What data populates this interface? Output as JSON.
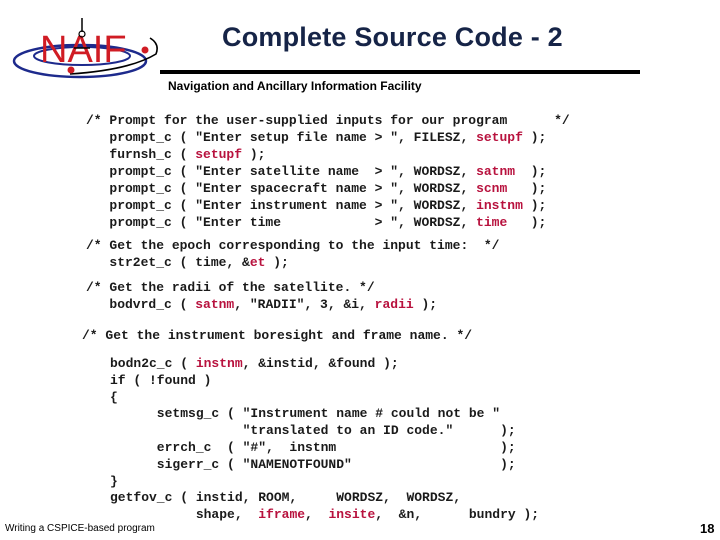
{
  "header": {
    "logo_text": "NAIF",
    "title": "Complete Source Code - 2",
    "subtitle": "Navigation and Ancillary Information Facility"
  },
  "colors": {
    "title": "#162447",
    "code_text": "#1a1a1a",
    "variable_highlight": "#b8123e",
    "logo_red": "#d01c24",
    "logo_orbit": "#1d2a8c"
  },
  "code_blocks": [
    {
      "name": "prompt-block",
      "lines": [
        [
          {
            "t": "/* Prompt for the user-supplied inputs for our program      */"
          }
        ],
        [
          {
            "t": "   prompt_c ( \"Enter setup file name > \", FILESZ, "
          },
          {
            "t": "setupf",
            "hl": true
          },
          {
            "t": " );"
          }
        ],
        [
          {
            "t": "   furnsh_c ( "
          },
          {
            "t": "setupf",
            "hl": true
          },
          {
            "t": " );"
          }
        ],
        [
          {
            "t": "   prompt_c ( \"Enter satellite name  > \", WORDSZ, "
          },
          {
            "t": "satnm",
            "hl": true
          },
          {
            "t": "  );"
          }
        ],
        [
          {
            "t": "   prompt_c ( \"Enter spacecraft name > \", WORDSZ, "
          },
          {
            "t": "scnm",
            "hl": true
          },
          {
            "t": "   );"
          }
        ],
        [
          {
            "t": "   prompt_c ( \"Enter instrument name > \", WORDSZ, "
          },
          {
            "t": "instnm",
            "hl": true
          },
          {
            "t": " );"
          }
        ],
        [
          {
            "t": "   prompt_c ( \"Enter time            > \", WORDSZ, "
          },
          {
            "t": "time",
            "hl": true
          },
          {
            "t": "   );"
          }
        ]
      ]
    },
    {
      "name": "epoch-block",
      "lines": [
        [
          {
            "t": "/* Get the epoch corresponding to the input time:  */"
          }
        ],
        [
          {
            "t": "   str2et_c ( time, &"
          },
          {
            "t": "et",
            "hl": true
          },
          {
            "t": " );"
          }
        ]
      ]
    },
    {
      "name": "radii-block",
      "lines": [
        [
          {
            "t": "/* Get the radii of the satellite. */"
          }
        ],
        [
          {
            "t": "   bodvrd_c ( "
          },
          {
            "t": "satnm",
            "hl": true
          },
          {
            "t": ", \"RADII\", 3, &i, "
          },
          {
            "t": "radii",
            "hl": true
          },
          {
            "t": " );"
          }
        ]
      ]
    },
    {
      "name": "boresight-comment",
      "lines": [
        [
          {
            "t": "/* Get the instrument boresight and frame name. */"
          }
        ]
      ]
    },
    {
      "name": "fov-block",
      "lines": [
        [
          {
            "t": "bodn2c_c ( "
          },
          {
            "t": "instnm",
            "hl": true
          },
          {
            "t": ", &instid, &found );"
          }
        ],
        [
          {
            "t": "if ( !found )"
          }
        ],
        [
          {
            "t": "{"
          }
        ],
        [
          {
            "t": "      setmsg_c ( \"Instrument name # could not be \""
          }
        ],
        [
          {
            "t": "                 \"translated to an ID code.\"      );"
          }
        ],
        [
          {
            "t": "      errch_c  ( \"#\",  instnm                     );"
          }
        ],
        [
          {
            "t": "      sigerr_c ( \"NAMENOTFOUND\"                   );"
          }
        ],
        [
          {
            "t": "}"
          }
        ],
        [
          {
            "t": "getfov_c ( instid, ROOM,     WORDSZ,  WORDSZ,"
          }
        ],
        [
          {
            "t": "           shape,  "
          },
          {
            "t": "iframe",
            "hl": true
          },
          {
            "t": ",  "
          },
          {
            "t": "insite",
            "hl": true
          },
          {
            "t": ",  &n,      bundry );"
          }
        ]
      ]
    }
  ],
  "footer": {
    "left_text": "Writing a CSPICE-based program",
    "page_number": "18"
  }
}
